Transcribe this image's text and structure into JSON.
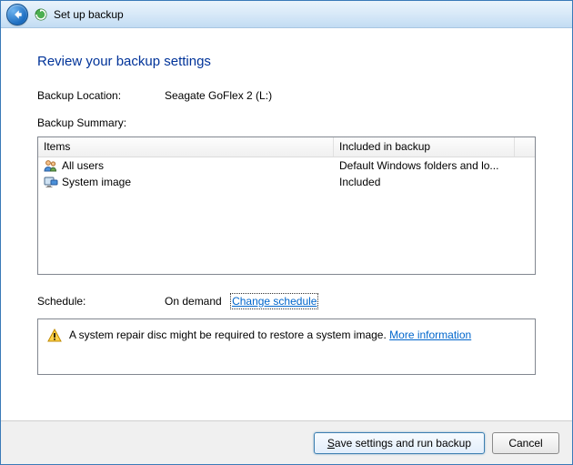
{
  "window": {
    "title": "Set up backup"
  },
  "page": {
    "heading": "Review your backup settings"
  },
  "location": {
    "label": "Backup Location:",
    "value": "Seagate GoFlex 2 (L:)"
  },
  "summary": {
    "label": "Backup Summary:",
    "columns": [
      "Items",
      "Included in backup"
    ],
    "rows": [
      {
        "icon": "users-icon",
        "item": "All users",
        "included": "Default Windows folders and lo..."
      },
      {
        "icon": "system-image-icon",
        "item": "System image",
        "included": "Included"
      }
    ]
  },
  "schedule": {
    "label": "Schedule:",
    "value": "On demand",
    "change_link": "Change schedule"
  },
  "notice": {
    "text": "A system repair disc might be required to restore a system image. ",
    "link": "More information"
  },
  "footer": {
    "save": "Save settings and run backup",
    "cancel": "Cancel"
  }
}
